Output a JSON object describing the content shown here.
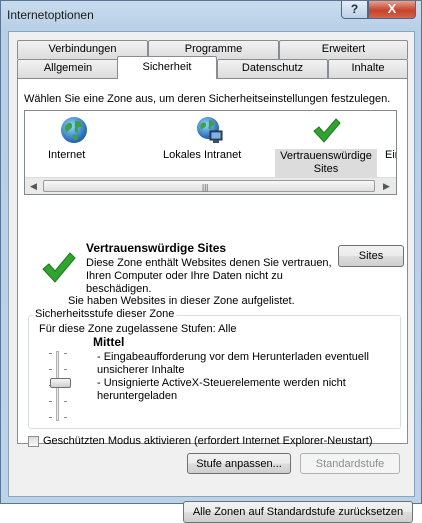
{
  "window": {
    "title": "Internetoptionen",
    "help_symbol": "?",
    "close_symbol": "X"
  },
  "tabs": {
    "row_back": [
      "Verbindungen",
      "Programme",
      "Erweitert"
    ],
    "row_front": [
      "Allgemein",
      "Sicherheit",
      "Datenschutz",
      "Inhalte"
    ],
    "active": "Sicherheit"
  },
  "security": {
    "zone_prompt": "Wählen Sie eine Zone aus, um deren Sicherheitseinstellungen festzulegen.",
    "zones": [
      {
        "label": "Internet",
        "icon": "globe-icon"
      },
      {
        "label": "Lokales Intranet",
        "icon": "intranet-globe-icon"
      },
      {
        "label": "Vertrauenswürdige\nSites",
        "label_line1": "Vertrauenswürdige",
        "label_line2": "Sites",
        "icon": "check-icon",
        "selected": true
      },
      {
        "label": "Einge",
        "icon": "restricted-icon"
      }
    ],
    "scroll_grip": "|||",
    "selected_zone": {
      "title": "Vertrauenswürdige Sites",
      "description": "Diese Zone enthält Websites denen Sie vertrauen, Ihren Computer oder Ihre Daten nicht zu beschädigen.",
      "listed": "Sie haben Websites in dieser Zone aufgelistet.",
      "sites_button": "Sites"
    },
    "level_group": {
      "label": "Sicherheitsstufe dieser Zone",
      "allowed": "Für diese Zone zugelassene Stufen: Alle",
      "level_name": "Mittel",
      "bullets": [
        "- Eingabeaufforderung vor dem Herunterladen eventuell unsicherer Inhalte",
        "- Unsignierte ActiveX-Steuerelemente werden nicht heruntergeladen"
      ],
      "slider_level": "Mittel"
    },
    "protected_mode": {
      "label": "Geschützten Modus aktivieren (erfordert Internet Explorer-Neustart)",
      "checked": false
    },
    "custom_level_button": "Stufe anpassen...",
    "default_level_button": "Standardstufe",
    "reset_all_button": "Alle Zonen auf Standardstufe zurücksetzen"
  },
  "colors": {
    "check_green": "#2fa52f",
    "window_frame": "#b7cfe7",
    "close_red": "#c7422b"
  }
}
